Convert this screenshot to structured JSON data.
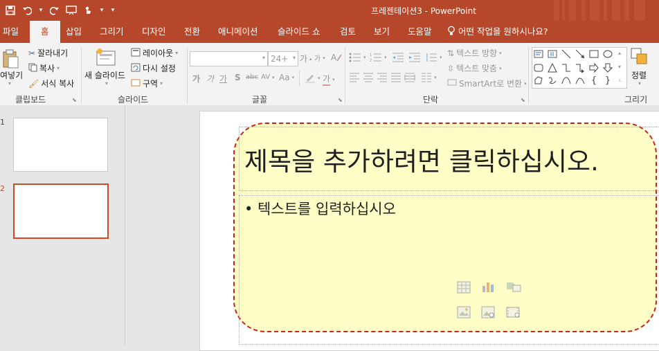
{
  "window": {
    "title": "프레젠테이션3  -  PowerPoint"
  },
  "qat": {
    "save_icon": "save-icon",
    "undo_icon": "undo-icon",
    "redo_icon": "redo-icon",
    "present_icon": "present-icon",
    "touch_icon": "touch-mode-icon",
    "customize": "▾"
  },
  "tabs": [
    {
      "label": "파일"
    },
    {
      "label": "홈",
      "active": true
    },
    {
      "label": "삽입"
    },
    {
      "label": "그리기"
    },
    {
      "label": "디자인"
    },
    {
      "label": "전환"
    },
    {
      "label": "애니메이션"
    },
    {
      "label": "슬라이드 쇼"
    },
    {
      "label": "검토"
    },
    {
      "label": "보기"
    },
    {
      "label": "도움말"
    }
  ],
  "tell_me": "어떤 작업을 원하시나요?",
  "ribbon": {
    "clipboard": {
      "paste": "여넣기",
      "cut": "잘라내기",
      "copy": "복사",
      "format_painter": "서식 복사",
      "label": "클립보드"
    },
    "slides": {
      "new_slide": "새 슬라이드",
      "layout": "레이아웃",
      "reset": "다시 설정",
      "section": "구역",
      "label": "슬라이드"
    },
    "font": {
      "font_name": "",
      "font_size": "24+",
      "grow": "가",
      "shrink": "가",
      "bold": "가",
      "italic": "가",
      "underline": "가",
      "shadow": "S",
      "strike": "abc",
      "spacing": "AV",
      "case": "Aa",
      "color": "가",
      "label": "글꼴"
    },
    "paragraph": {
      "text_direction": "텍스트 방향",
      "align_text": "텍스트 맞춤",
      "smartart": "SmartArt로 변환",
      "label": "단락"
    },
    "drawing": {
      "arrange": "정렬",
      "label": "그리기"
    }
  },
  "thumbnails": [
    {
      "num": "1",
      "selected": false
    },
    {
      "num": "2",
      "selected": true
    }
  ],
  "slide": {
    "title_placeholder": "제목을 추가하려면 클릭하십시오.",
    "body_placeholder": "• 텍스트를 입력하십시오"
  },
  "colors": {
    "accent": "#b7472a",
    "selection": "#d24726",
    "highlight_fill": "#fefec6",
    "highlight_border": "#cc1f1f"
  }
}
